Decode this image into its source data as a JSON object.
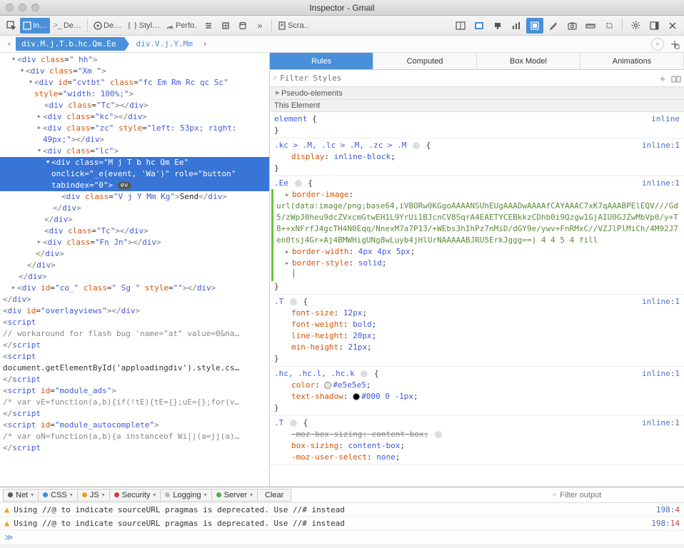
{
  "window": {
    "title": "Inspector - Gmail"
  },
  "toolbar": {
    "inspector_label": "In…",
    "console_label": "De…",
    "styles_label": "Styl…",
    "perf_label": "Perfo…",
    "scratch_label": "Scra…"
  },
  "breadcrumbs": {
    "item1": "div.M.j.T.b.hc.Qm.Ee",
    "item2": "div.V.j.Y.Mm"
  },
  "dom": {
    "l1": "<div class=\" hh\">",
    "l2": "<div class=\"Xm \">",
    "l3_a": "<div id=\"",
    "l3_id": "cvtbt",
    "l3_b": "\" class=\"",
    "l3_cls": "fc Em Rm Rc qc Sc",
    "l3_c": "\"",
    "l4_a": "style=\"",
    "l4_v": "width: 100%;",
    "l4_b": "\">",
    "l5": "<div class=\"Tc\"></div>",
    "l6": "<div class=\"kc\"></div>",
    "l7_a": "<div class=\"",
    "l7_cls": "zc",
    "l7_b": "\" style=\"",
    "l7_v": "left: 53px; right:",
    "l8_v": "49px;",
    "l8_b": "\"></div>",
    "l9": "<div class=\"lc\">",
    "l10_a": "<div class=\"",
    "l10_cls": "M j T b hc Qm Ee",
    "l10_b": "\"",
    "l11_a": "onclick=\"",
    "l11_v": "_e(event, 'Wa')",
    "l11_b": "\" role=\"",
    "l11_r": "button",
    "l11_c": "\"",
    "l12_a": "tabindex=\"",
    "l12_v": "0",
    "l12_b": "\"> ",
    "l13_a": "<div class=\"",
    "l13_cls": "V j Y Mm Kg",
    "l13_b": "\">",
    "l13_t": "Send",
    "l13_c": "</div>",
    "l14": "</div>",
    "l15": "</div>",
    "l16": "<div class=\"Tc\"></div>",
    "l17_a": "<div class=\"",
    "l17_cls": "Fn Jn",
    "l17_b": "\"></div>",
    "l18": "</div>",
    "l19": "</div>",
    "l20": "</div>",
    "l21_a": "<div id=\"",
    "l21_id": "co_",
    "l21_b": "\" class=\"",
    "l21_cls": " Sg ",
    "l21_c": "\" style=\"\"></div>",
    "l22": "</div>",
    "l23_a": "<div id=\"",
    "l23_id": "overlayviews",
    "l23_b": "\"></div>",
    "l24": "<script",
    "l25": "// workaround for flash bug 'name=\"at\" value=0&na…",
    "l26": "</script",
    "l27": "<script",
    "l28": "document.getElementById('apploadingdiv').style.cs…",
    "l29": "</script",
    "l30_a": "<script id=\"",
    "l30_id": "module_ads",
    "l30_b": "\">",
    "l31": "/* var vE=function(a,b){if(!tE){tE={};uE={};for(v…",
    "l32": "</script",
    "l33_a": "<script id=\"",
    "l33_id": "module_autocomplete",
    "l33_b": "\">",
    "l34": "/* var oN=function(a,b){a instanceof Wi||(a=jj(a)…",
    "l35": "</script"
  },
  "rules": {
    "tabs": {
      "rules": "Rules",
      "computed": "Computed",
      "boxmodel": "Box Model",
      "animations": "Animations"
    },
    "filter_placeholder": "Filter Styles",
    "pseudo_header": "Pseudo-elements",
    "this_element": "This Element",
    "inline_label": "inline",
    "inline1_label": "inline:1",
    "r1_sel": "element",
    "r2_sel": ".kc > .M, .lc > .M, .zc > .M",
    "r2_p1n": "display",
    "r2_p1v": "inline-block",
    "r3_sel": ".Ee",
    "r3_p1n": "border-image",
    "r3_url": "url(data:image/png;base64,iVBORw0KGgoAAAANSUhEUgAAADwAAAAfCAYAAAC7xK7qAAABPElEQV///Gd5/zWpJ0heu9dcZVxcmGtwEH1L9YrUi1BJcnCV8SqrA4EAETYCEBkkzCDhb0i9Qzgw1GjAIU0GJZwMbVp0/y+T8++xNFrfJ4gcTH4N0Eqq/NnexM7a7P13/+WEbs3hIhPz7nMiD/dGY9e/ywv+FnRMxC//VZJlPlMiCh/4M92J7en0tsj4Gr+Aj4BMWHigUNg8wLuyb4jHlUrNAAAAABJRU5ErkJggg==) 4 4 5 4 fill",
    "r3_p2n": "border-width",
    "r3_p2v": "4px 4px 5px",
    "r3_p3n": "border-style",
    "r3_p3v": "solid",
    "r4_sel": ".T",
    "r4_p1n": "font-size",
    "r4_p1v": "12px",
    "r4_p2n": "font-weight",
    "r4_p2v": "bold",
    "r4_p3n": "line-height",
    "r4_p3v": "20px",
    "r4_p4n": "min-height",
    "r4_p4v": "21px",
    "r5_sel": ".hc, .hc.l, .hc.k",
    "r5_p1n": "color",
    "r5_p1v": "#e5e5e5",
    "r5_p2n": "text-shadow",
    "r5_p2v": "#000 0 -1px",
    "r6_sel": ".T",
    "r6_p1n": "-moz-box-sizing",
    "r6_p1v": "content-box",
    "r6_p2n": "box-sizing",
    "r6_p2v": "content-box",
    "r6_p3n": "-moz-user-select",
    "r6_p3v": "none"
  },
  "console": {
    "filters": {
      "net": "Net",
      "css": "CSS",
      "js": "JS",
      "security": "Security",
      "logging": "Logging",
      "server": "Server",
      "clear": "Clear"
    },
    "filter_placeholder": "Filter output",
    "msg1": "Using //@ to indicate sourceURL pragmas is deprecated. Use //# instead",
    "loc1_line": "198",
    "loc1_col": "4",
    "msg2": "Using //@ to indicate sourceURL pragmas is deprecated. Use //# instead",
    "loc2_line": "198",
    "loc2_col": "14",
    "prompt": "≫"
  }
}
